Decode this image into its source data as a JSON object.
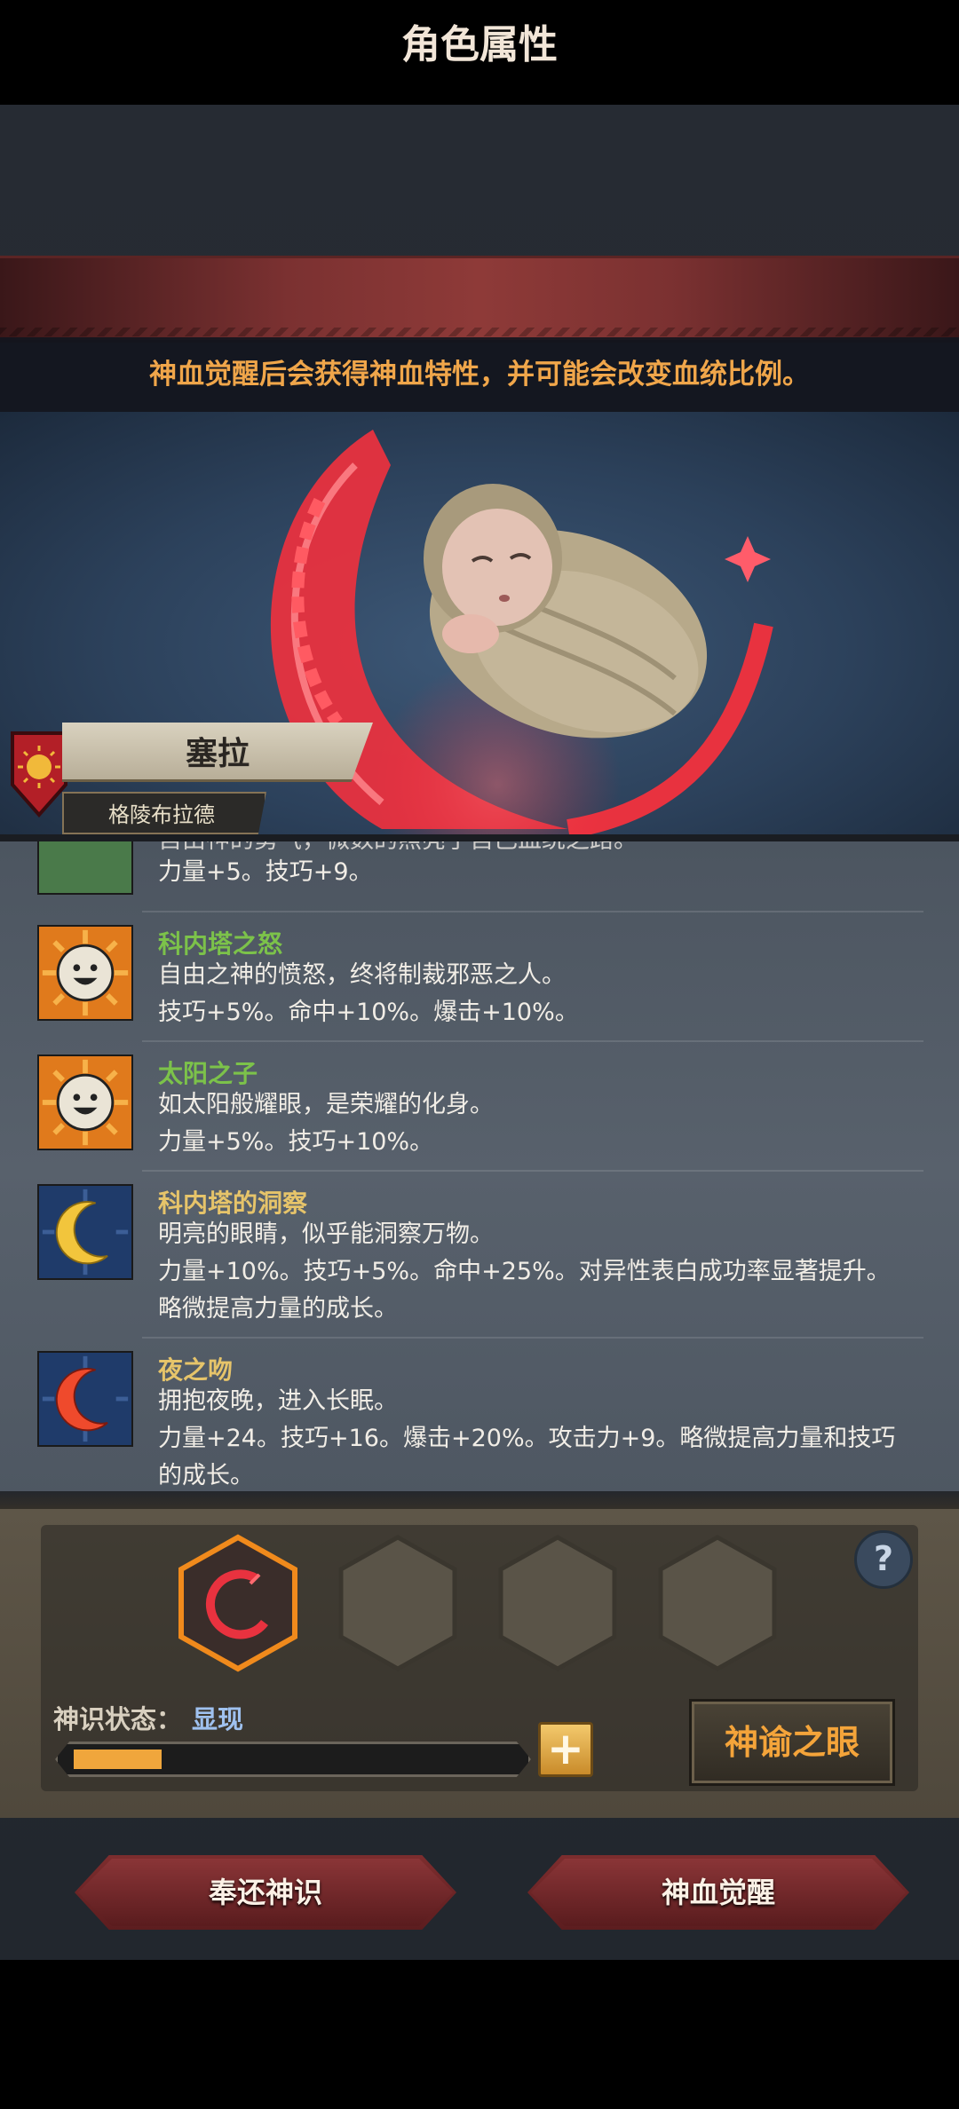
{
  "header": {
    "title": "角色属性",
    "notice": "神血觉醒后会获得神血特性，并可能会改变血统比例。"
  },
  "character": {
    "name": "塞拉",
    "house": "格陵布拉德"
  },
  "traits": [
    {
      "name": "",
      "lines": [
        "自由神的勇气，微数的照亮了自己血统之路。",
        "力量+5。技巧+9。"
      ],
      "name_color": "#e6c46a",
      "icon": "partial-trait-icon"
    },
    {
      "name": "科内塔之怒",
      "lines": [
        "自由之神的愤怒，终将制裁邪恶之人。",
        "技巧+5%。命中+10%。爆击+10%。"
      ],
      "name_color": "#7cc24a",
      "icon": "sun-face-icon"
    },
    {
      "name": "太阳之子",
      "lines": [
        "如太阳般耀眼，是荣耀的化身。",
        "力量+5%。技巧+10%。"
      ],
      "name_color": "#7cc24a",
      "icon": "sun-face-icon"
    },
    {
      "name": "科内塔的洞察",
      "lines": [
        "明亮的眼睛，似乎能洞察万物。",
        "力量+10%。技巧+5%。命中+25%。对异性表白成功率显著提升。",
        "略微提高力量的成长。"
      ],
      "name_color": "#e6c46a",
      "icon": "crescent-moon-icon"
    },
    {
      "name": "夜之吻",
      "lines": [
        "拥抱夜晚，进入长眠。",
        "力量+24。技巧+16。爆击+20%。攻击力+9。略微提高力量和技巧",
        "的成长。"
      ],
      "name_color": "#e6c46a",
      "icon": "red-crescent-icon"
    }
  ],
  "divine": {
    "status_label": "神识状态：",
    "status_value": "显现",
    "progress": 0.2,
    "oracle_button": "神谕之眼",
    "plus_label": "+",
    "help_label": "?"
  },
  "actions": {
    "return_label": "奉还神识",
    "awaken_label": "神血觉醒"
  },
  "colors": {
    "accent_orange": "#f0a63c",
    "banner_red": "#7b3131",
    "trait_green": "#7cc24a",
    "trait_gold": "#e6c46a",
    "status_blue": "#9fc1ef"
  }
}
